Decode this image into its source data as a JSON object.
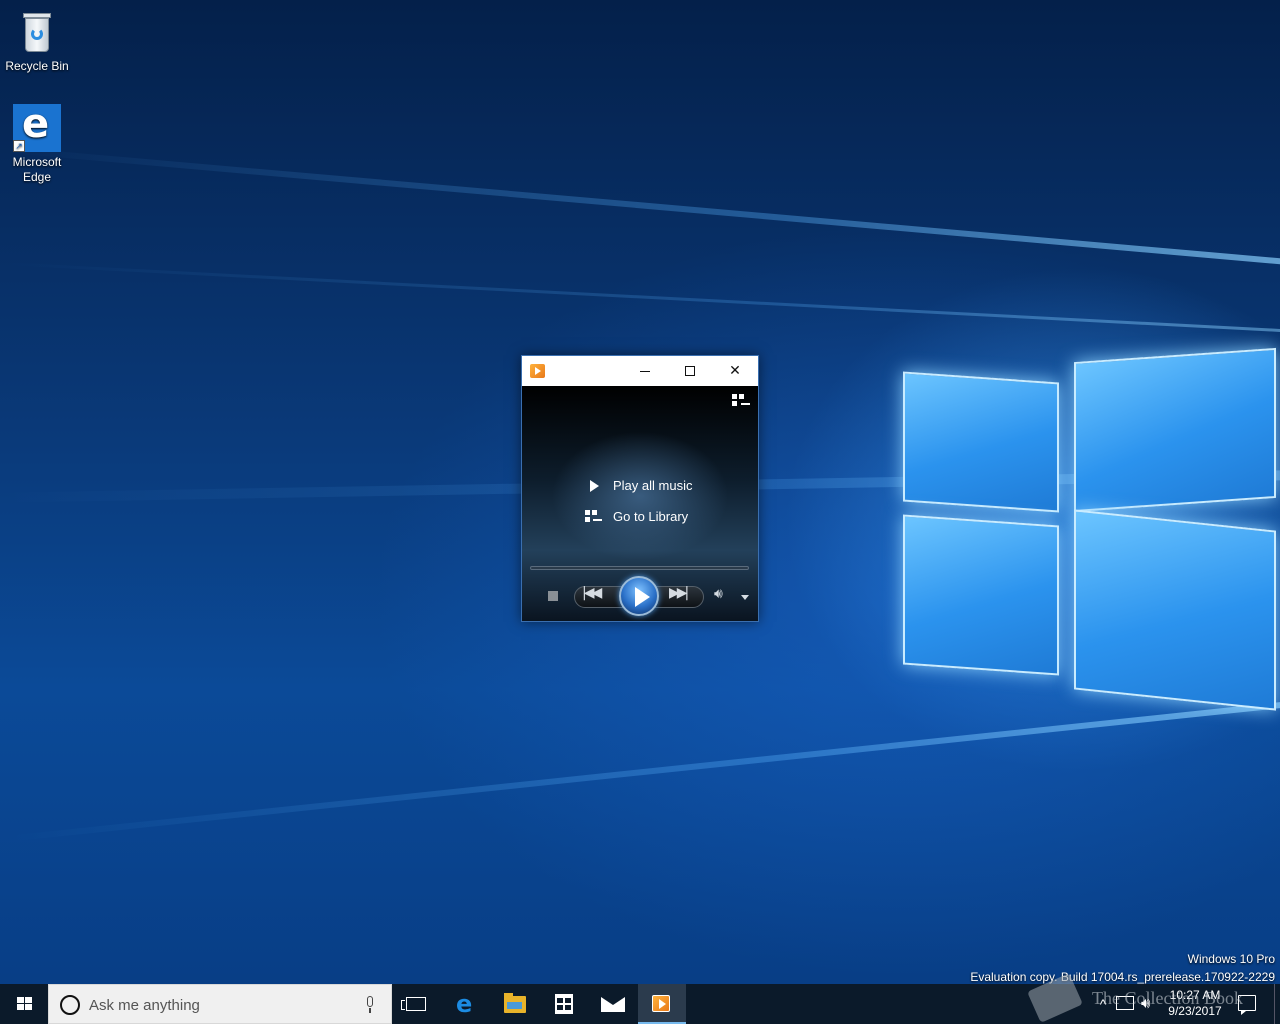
{
  "desktop": {
    "icons": [
      {
        "label": "Recycle Bin",
        "icon": "recycle-bin-icon"
      },
      {
        "label": "Microsoft Edge",
        "icon": "edge-icon"
      }
    ],
    "watermark": {
      "line1": "Windows 10 Pro",
      "line2": "Evaluation copy. Build 17004.rs_prerelease.170922-2229"
    }
  },
  "media_player": {
    "title_icon": "windows-media-player-icon",
    "switch_to_library_icon": "switch-to-library-icon",
    "menu": {
      "play_all": "Play all music",
      "go_to_library": "Go to Library"
    },
    "controls": [
      "stop-icon",
      "previous-icon",
      "play-icon",
      "next-icon",
      "volume-icon",
      "volume-dropdown-icon"
    ]
  },
  "taskbar": {
    "search": {
      "placeholder": "Ask me anything"
    },
    "pinned": [
      "task-view-icon",
      "edge-icon",
      "file-explorer-icon",
      "store-icon",
      "mail-icon",
      "windows-media-player-icon"
    ],
    "active_app": "windows-media-player-icon",
    "clock": {
      "time": "10:27 AM",
      "date": "9/23/2017"
    }
  },
  "overlay": {
    "text": "The Collection Book"
  },
  "colors": {
    "taskbar": "#0b1a2a",
    "accent": "#76b9ed",
    "wallpaper_dark": "#04204a",
    "wallpaper_light": "#6cc5ff"
  }
}
